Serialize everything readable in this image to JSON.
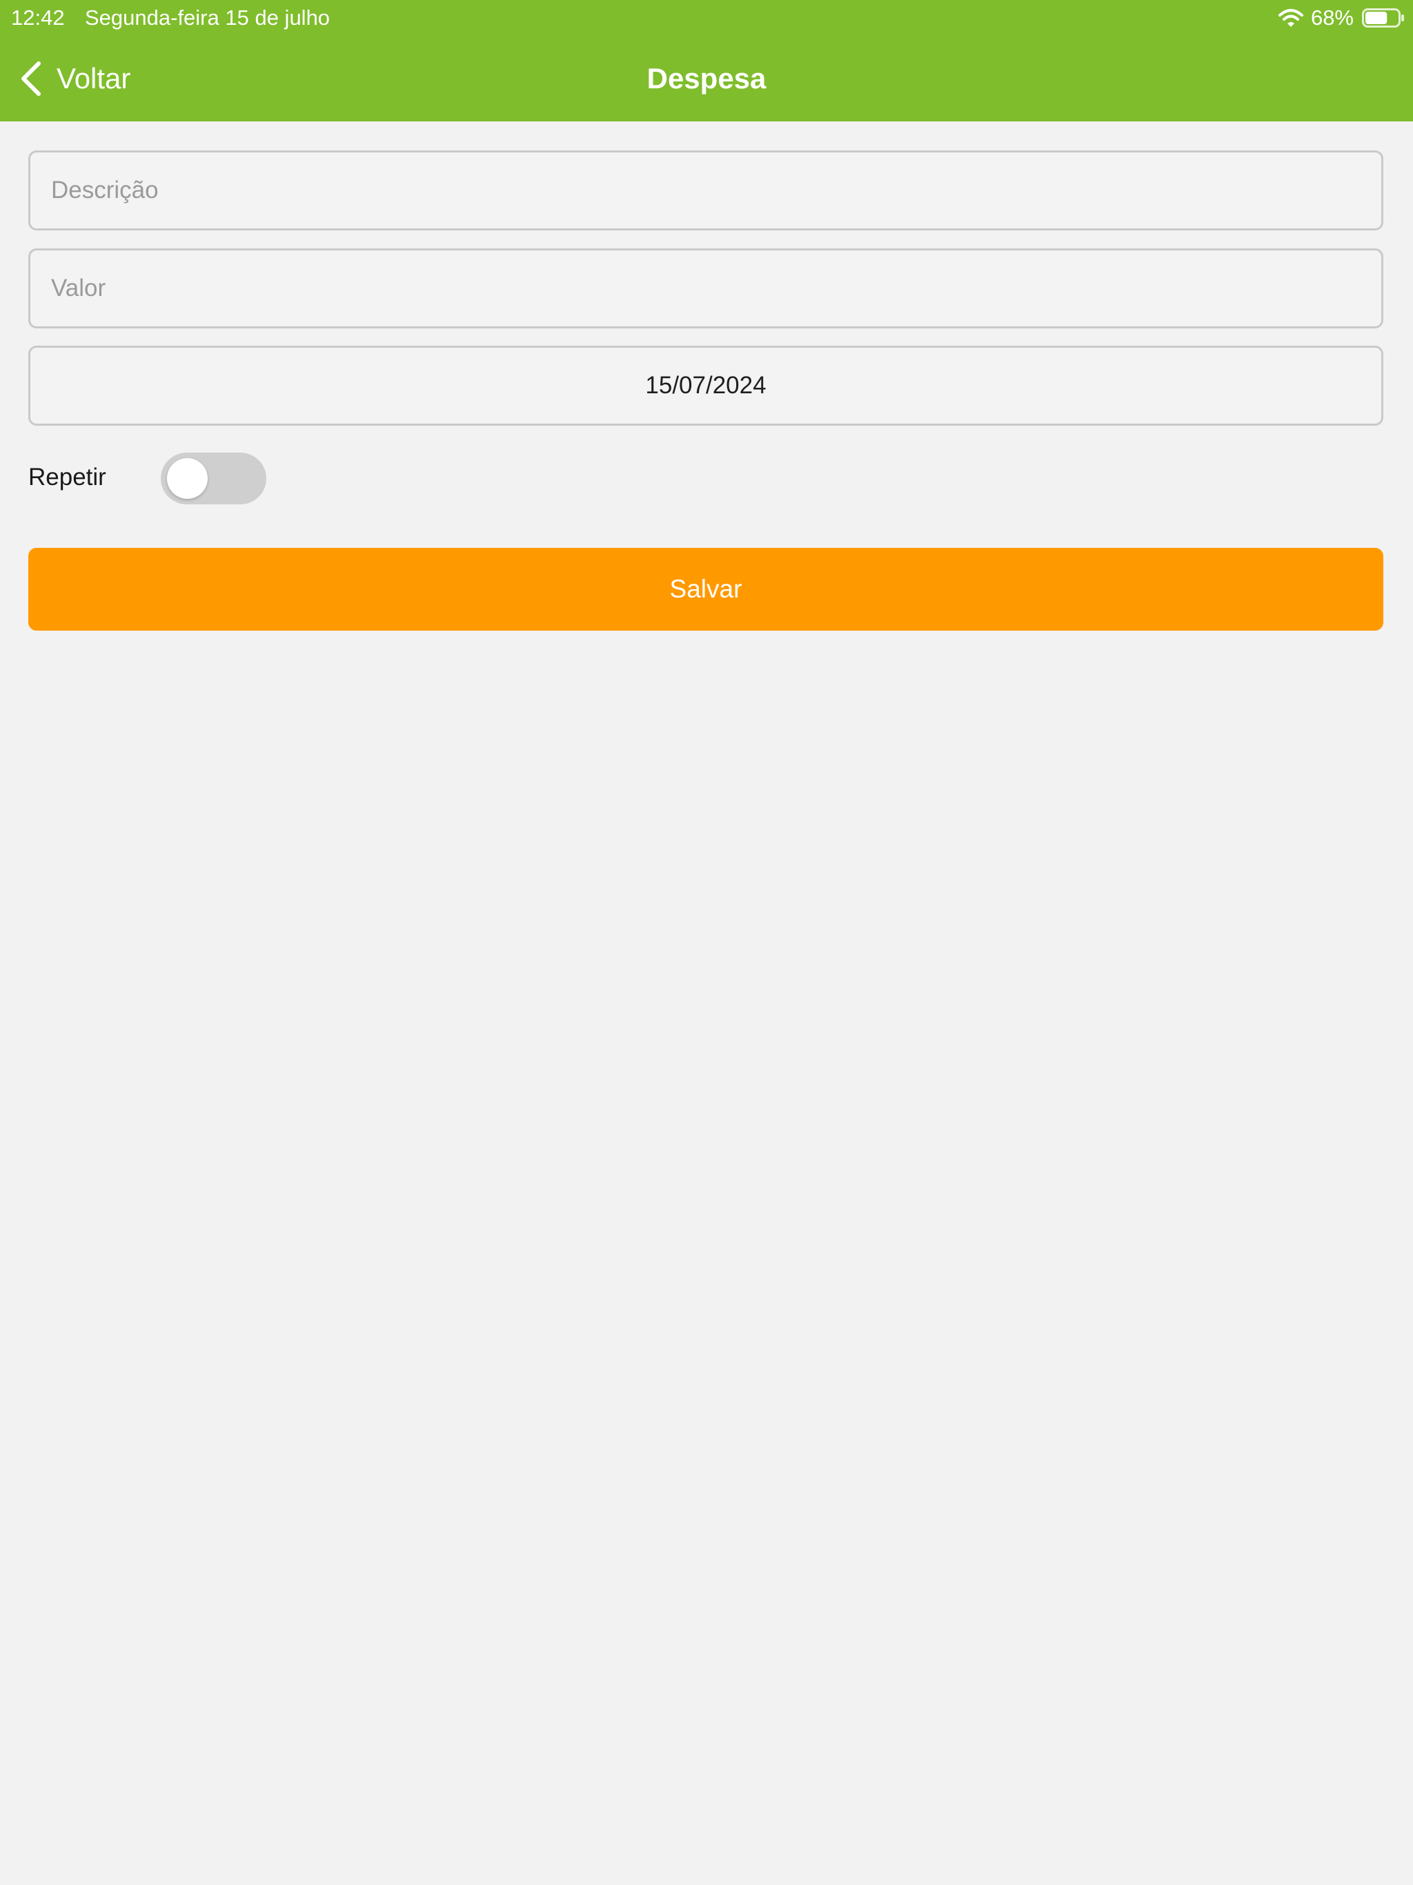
{
  "status_bar": {
    "time": "12:42",
    "date": "Segunda-feira 15 de julho",
    "battery_percent": "68%",
    "battery_level": 0.68,
    "wifi_icon": "wifi-icon",
    "battery_icon": "battery-icon"
  },
  "nav": {
    "back_label": "Voltar",
    "back_icon": "chevron-left-icon",
    "title": "Despesa"
  },
  "form": {
    "description_placeholder": "Descrição",
    "description_value": "",
    "value_placeholder": "Valor",
    "value_value": "",
    "date_value": "15/07/2024",
    "repeat_label": "Repetir",
    "repeat_on": false,
    "save_label": "Salvar"
  },
  "colors": {
    "header": "#7fbd2c",
    "save_button": "#ff9900",
    "background": "#f2f2f2",
    "toggle_off": "#cfcfcf"
  }
}
